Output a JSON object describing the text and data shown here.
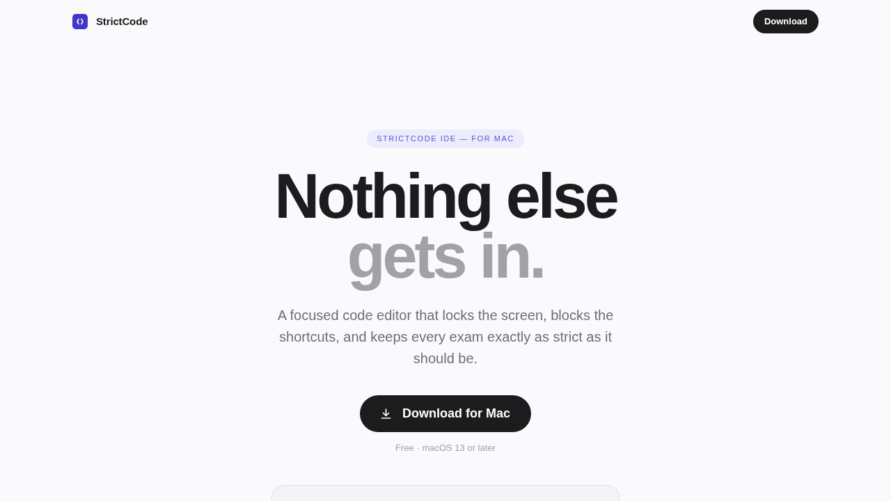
{
  "nav": {
    "brand": "StrictCode",
    "button": "Download"
  },
  "hero": {
    "badge": "STRICTCODE IDE — FOR MAC",
    "headline": [
      {
        "text": "Nothing else",
        "kind": "primary"
      },
      {
        "text": "gets in.",
        "kind": "muted"
      }
    ],
    "description": "A focused code editor that locks the screen, blocks the shortcuts, and keeps every exam exactly as strict as it should be.",
    "cta": "Download for Mac",
    "note": "Free · macOS 13 or later"
  }
}
